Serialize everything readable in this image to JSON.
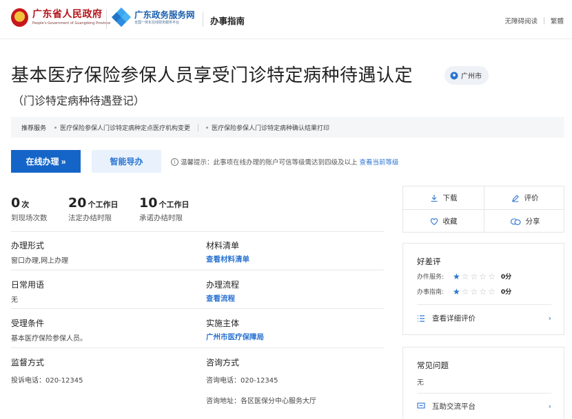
{
  "header": {
    "gov_name": "广东省人民政府",
    "gov_name_en": "People's Government of Guangdong Province",
    "service_name": "广东政务服务网",
    "service_slogan": "全国一体化在线政务服务平台",
    "section": "办事指南",
    "accessibility": "无障碍阅读",
    "traditional": "繁體"
  },
  "title": "基本医疗保险参保人员享受门诊特定病种待遇认定",
  "location": "广州市",
  "subtitle": "（门诊特定病种待遇登记）",
  "recommend": {
    "label": "推荐服务",
    "items": [
      "医疗保险参保人门诊特定病种定点医疗机构变更",
      "医疗保险参保人门诊特定病种确认结果打印"
    ]
  },
  "buttons": {
    "online": "在线办理 »",
    "smart": "智能导办"
  },
  "tip": {
    "text": "温馨提示：此事项在线办理的账户可信等级需达到四级及以上",
    "link": "查看当前等级"
  },
  "stats": [
    {
      "num": "0",
      "unit": "次",
      "label": "到现场次数"
    },
    {
      "num": "20",
      "unit": "个工作日",
      "label": "法定办结时限"
    },
    {
      "num": "10",
      "unit": "个工作日",
      "label": "承诺办结时限"
    }
  ],
  "info": {
    "form_h": "办理形式",
    "form_v": "窗口办理,网上办理",
    "materials_h": "材料清单",
    "materials_link": "查看材料清单",
    "phrases_h": "日常用语",
    "phrases_v": "无",
    "process_h": "办理流程",
    "process_link": "查看流程",
    "condition_h": "受理条件",
    "condition_v": "基本医疗保险参保人员。",
    "agency_h": "实施主体",
    "agency_link": "广州市医疗保障局",
    "supervise_h": "监督方式",
    "supervise_v": "投诉电话：020-12345",
    "consult_h": "咨询方式",
    "consult_phone": "咨询电话：020-12345",
    "consult_addr": "咨询地址：各区医保分中心服务大厅"
  },
  "actions": {
    "download": "下载",
    "rate": "评价",
    "favorite": "收藏",
    "share": "分享"
  },
  "rating": {
    "title": "好差评",
    "service_label": "办件服务:",
    "service_score": "0分",
    "service_stars": 1,
    "guide_label": "办事指南:",
    "guide_score": "0分",
    "guide_stars": 1,
    "detail_link": "查看详细评价"
  },
  "faq": {
    "title": "常见问题",
    "value": "无",
    "platform_link": "互助交流平台"
  },
  "colors": {
    "primary": "#1565c8",
    "link": "#2b74d2",
    "gov_red": "#b5121b"
  }
}
